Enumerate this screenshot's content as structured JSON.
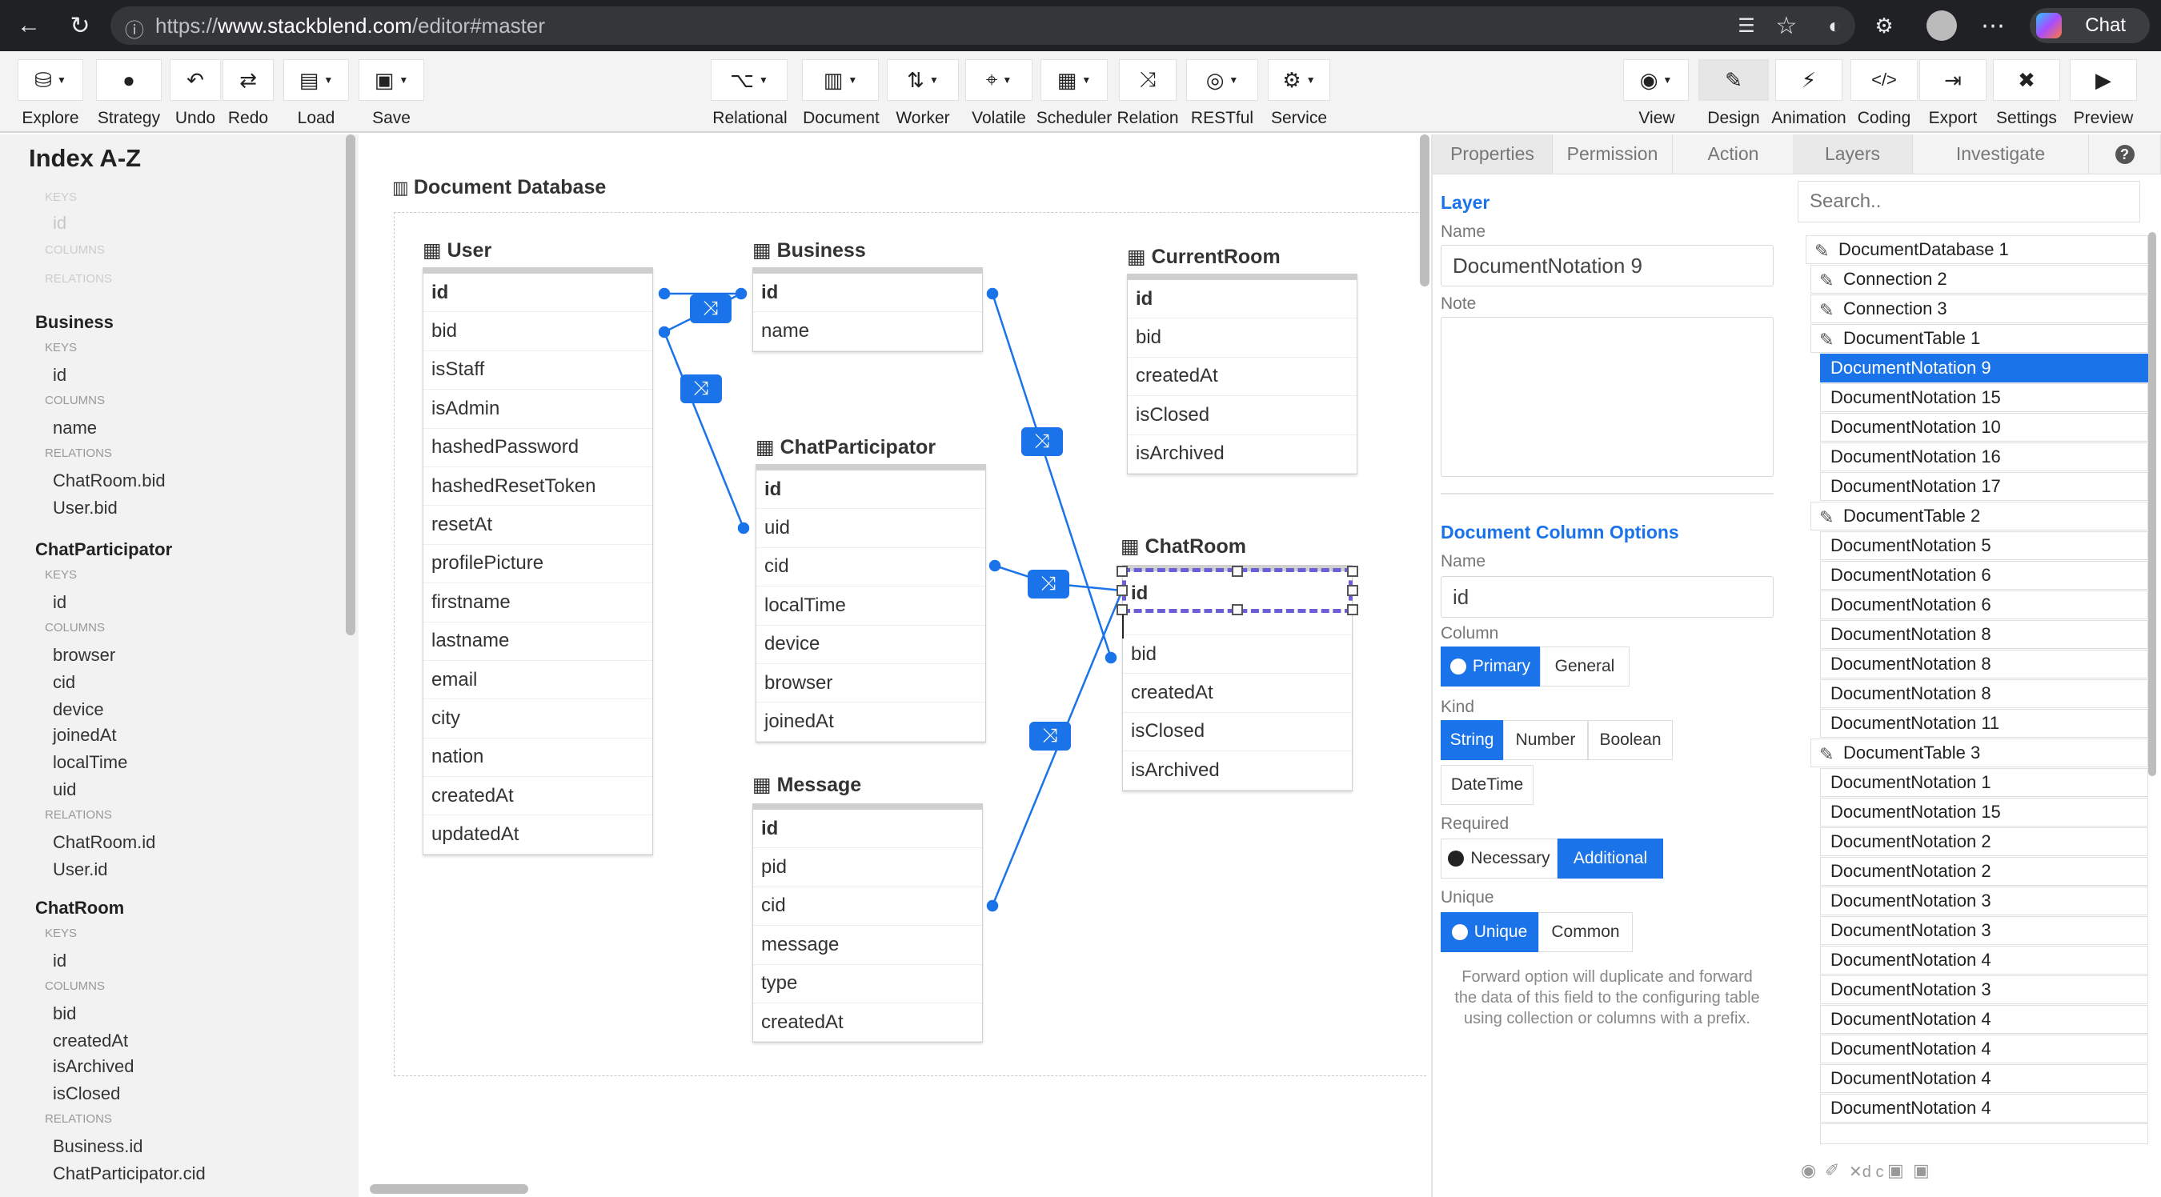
{
  "browser": {
    "url_scheme": "https://",
    "url_host": "www.stackblend.com",
    "url_path": "/editor#master",
    "chat_label": "Chat"
  },
  "toolbar": {
    "left": [
      {
        "label": "Explore",
        "icon": "database-icon"
      },
      {
        "label": "Strategy",
        "icon": "bulb-icon"
      },
      {
        "label": "Undo",
        "icon": "undo-icon"
      },
      {
        "label": "Redo",
        "icon": "redo-icon"
      },
      {
        "label": "Load",
        "icon": "folder-icon"
      },
      {
        "label": "Save",
        "icon": "save-icon"
      }
    ],
    "center": [
      {
        "label": "Relational",
        "icon": "share-icon"
      },
      {
        "label": "Document",
        "icon": "file-icon"
      },
      {
        "label": "Worker",
        "icon": "sort-icon"
      },
      {
        "label": "Volatile",
        "icon": "pin-icon"
      },
      {
        "label": "Scheduler",
        "icon": "calendar-icon"
      },
      {
        "label": "Relation",
        "icon": "shuffle-icon"
      },
      {
        "label": "RESTful",
        "icon": "globe-icon"
      },
      {
        "label": "Service",
        "icon": "cogs-icon"
      }
    ],
    "right": [
      {
        "label": "View",
        "icon": "eye-icon"
      },
      {
        "label": "Design",
        "icon": "brush-icon"
      },
      {
        "label": "Animation",
        "icon": "bolt-icon"
      },
      {
        "label": "Coding",
        "icon": "code-icon"
      },
      {
        "label": "Export",
        "icon": "export-icon"
      },
      {
        "label": "Settings",
        "icon": "tools-icon"
      },
      {
        "label": "Preview",
        "icon": "play-icon"
      }
    ]
  },
  "index": {
    "title": "Index A-Z",
    "faint": {
      "keys": "KEYS",
      "key": "id",
      "columns": "COLUMNS",
      "relations": "RELATIONS"
    },
    "business": {
      "name": "Business",
      "keys": "KEYS",
      "key": "id",
      "columns": "COLUMNS",
      "col1": "name",
      "relations": "RELATIONS",
      "rel1": "ChatRoom.bid",
      "rel2": "User.bid"
    },
    "chatparticipator": {
      "name": "ChatParticipator",
      "keys": "KEYS",
      "key": "id",
      "columns": "COLUMNS",
      "col1": "browser",
      "col2": "cid",
      "col3": "device",
      "col4": "joinedAt",
      "col5": "localTime",
      "col6": "uid",
      "relations": "RELATIONS",
      "rel1": "ChatRoom.id",
      "rel2": "User.id"
    },
    "chatroom": {
      "name": "ChatRoom",
      "keys": "KEYS",
      "key": "id",
      "columns": "COLUMNS",
      "col1": "bid",
      "col2": "createdAt",
      "col3": "isArchived",
      "col4": "isClosed",
      "relations": "RELATIONS",
      "rel1": "Business.id",
      "rel2": "ChatParticipator.cid"
    }
  },
  "canvas": {
    "database_title": "Document Database",
    "tables": {
      "user": {
        "name": "User",
        "rows": [
          "id",
          "bid",
          "isStaff",
          "isAdmin",
          "hashedPassword",
          "hashedResetToken",
          "resetAt",
          "profilePicture",
          "firstname",
          "lastname",
          "email",
          "city",
          "nation",
          "createdAt",
          "updatedAt"
        ]
      },
      "business": {
        "name": "Business",
        "rows": [
          "id",
          "name"
        ]
      },
      "currentroom": {
        "name": "CurrentRoom",
        "rows": [
          "id",
          "bid",
          "createdAt",
          "isClosed",
          "isArchived"
        ]
      },
      "chatparticipator": {
        "name": "ChatParticipator",
        "rows": [
          "id",
          "uid",
          "cid",
          "localTime",
          "device",
          "browser",
          "joinedAt"
        ]
      },
      "chatroom": {
        "name": "ChatRoom",
        "rows": [
          "id",
          "bid",
          "createdAt",
          "isClosed",
          "isArchived"
        ]
      },
      "message": {
        "name": "Message",
        "rows": [
          "id",
          "pid",
          "cid",
          "message",
          "type",
          "createdAt"
        ]
      }
    }
  },
  "properties": {
    "tabs": [
      "Properties",
      "Permission",
      "Action"
    ],
    "layer_section": "Layer",
    "name_label": "Name",
    "layer_name": "DocumentNotation 9",
    "note_label": "Note",
    "column_section": "Document Column Options",
    "col_name_label": "Name",
    "col_name": "id",
    "column_label": "Column",
    "column_opts": [
      "Primary",
      "General"
    ],
    "kind_label": "Kind",
    "kind_opts": [
      "String",
      "Number",
      "Boolean",
      "DateTime"
    ],
    "required_label": "Required",
    "required_opts": [
      "Necessary",
      "Additional"
    ],
    "unique_label": "Unique",
    "unique_opts": [
      "Unique",
      "Common"
    ],
    "forward_note": [
      "Forward option will duplicate and forward",
      "the data of this field to the configuring table",
      "using collection or columns with a prefix."
    ]
  },
  "layers": {
    "tabs": [
      "Layers",
      "Investigate"
    ],
    "search_placeholder": "Search..",
    "items": [
      "DocumentDatabase 1",
      "Connection 2",
      "Connection 3",
      "DocumentTable 1",
      "DocumentNotation 9",
      "DocumentNotation 15",
      "DocumentNotation 10",
      "DocumentNotation 16",
      "DocumentNotation 17",
      "DocumentTable 2",
      "DocumentNotation 5",
      "DocumentNotation 6",
      "DocumentNotation 6",
      "DocumentNotation 8",
      "DocumentNotation 8",
      "DocumentNotation 8",
      "DocumentNotation 11",
      "DocumentTable 3",
      "DocumentNotation 1",
      "DocumentNotation 15",
      "DocumentNotation 2",
      "DocumentNotation 2",
      "DocumentNotation 3",
      "DocumentNotation 3",
      "DocumentNotation 4",
      "DocumentNotation 3",
      "DocumentNotation 4",
      "DocumentNotation 4",
      "DocumentNotation 4",
      "DocumentNotation 4"
    ],
    "footer_icons": [
      "eye-icon",
      "eraser-icon",
      "x-icon",
      "d-icon",
      "lock-icon",
      "c-icon",
      "lock-icon"
    ],
    "footer_text": "✕d  c"
  },
  "colors": {
    "accent": "#1a73e8",
    "selection": "#6a5fd8",
    "toolbar_bg": "#f3f3f3",
    "chrome_bg": "#202124"
  }
}
